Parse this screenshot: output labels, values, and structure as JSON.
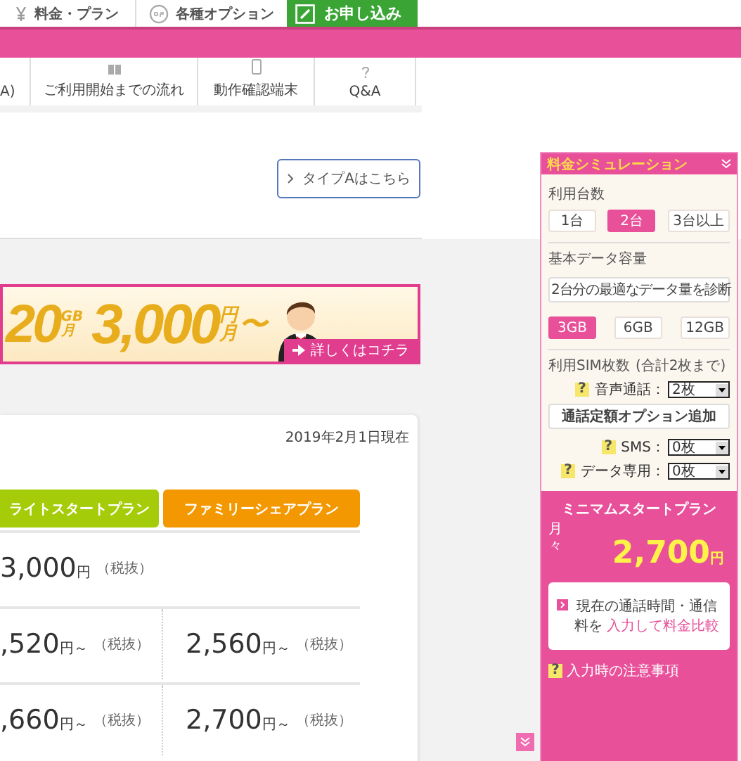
{
  "top_nav": {
    "items": [
      {
        "label": "料金・プラン"
      },
      {
        "label": "各種オプション"
      }
    ],
    "apply_button": "お申し込み"
  },
  "sub_nav": [
    {
      "label": "A)"
    },
    {
      "label": "ご利用開始までの流れ"
    },
    {
      "label": "動作確認端末"
    },
    {
      "label": "Q&A"
    }
  ],
  "type_a_link": "タイプAはこちら",
  "banner": {
    "capacity": "20",
    "capacity_unit": "GB",
    "per": "月",
    "price": "3,000",
    "price_unit": "円",
    "price_per": "月",
    "tilde": "〜",
    "cta": "詳しくはコチラ"
  },
  "price_table": {
    "date": "2019年2月1日現在",
    "plans": [
      {
        "name": "ライトスタートプラン",
        "color": "#a5cc08"
      },
      {
        "name": "ファミリーシェアプラン",
        "color": "#f39800"
      }
    ],
    "rows": [
      {
        "cells": [
          {
            "amount": "3,000",
            "unit": "円",
            "tax": "（税抜）"
          }
        ]
      },
      {
        "cells": [
          {
            "amount": ",520",
            "unit": "円～",
            "tax": "（税抜）"
          },
          {
            "amount": "2,560",
            "unit": "円～",
            "tax": "（税抜）"
          }
        ]
      },
      {
        "cells": [
          {
            "amount": ",660",
            "unit": "円～",
            "tax": "（税抜）"
          },
          {
            "amount": "2,700",
            "unit": "円～",
            "tax": "（税抜）"
          }
        ]
      }
    ]
  },
  "simulator": {
    "title": "料金シミュレーション",
    "devices": {
      "label": "利用台数",
      "options": [
        {
          "label": "1台",
          "selected": false
        },
        {
          "label": "2台",
          "selected": true
        },
        {
          "label": "3台以上",
          "selected": false
        }
      ]
    },
    "data": {
      "label": "基本データ容量",
      "diagnose_button": "2台分の最適なデータ量を診断",
      "options": [
        {
          "label": "3GB",
          "selected": true
        },
        {
          "label": "6GB",
          "selected": false
        },
        {
          "label": "12GB",
          "selected": false
        }
      ]
    },
    "sims": {
      "label": "利用SIM枚数",
      "note": "(合計2枚まで)",
      "lines": [
        {
          "kind": "select",
          "help": "?",
          "label": "音声通話：",
          "value": "2枚"
        },
        {
          "kind": "button",
          "label": "通話定額オプション追加"
        },
        {
          "kind": "select",
          "help": "?",
          "label": "SMS：",
          "value": "0枚"
        },
        {
          "kind": "select",
          "help": "?",
          "label": "データ専用：",
          "value": "0枚"
        }
      ]
    },
    "result": {
      "plan": "ミニマムスタートプラン",
      "period": "月々",
      "price": "2,700",
      "unit": "円"
    },
    "compare": {
      "text": "現在の通話時間・通信料を",
      "link": "入力して料金比較"
    },
    "notes_link": {
      "help": "?",
      "label": "入力時の注意事項"
    }
  }
}
